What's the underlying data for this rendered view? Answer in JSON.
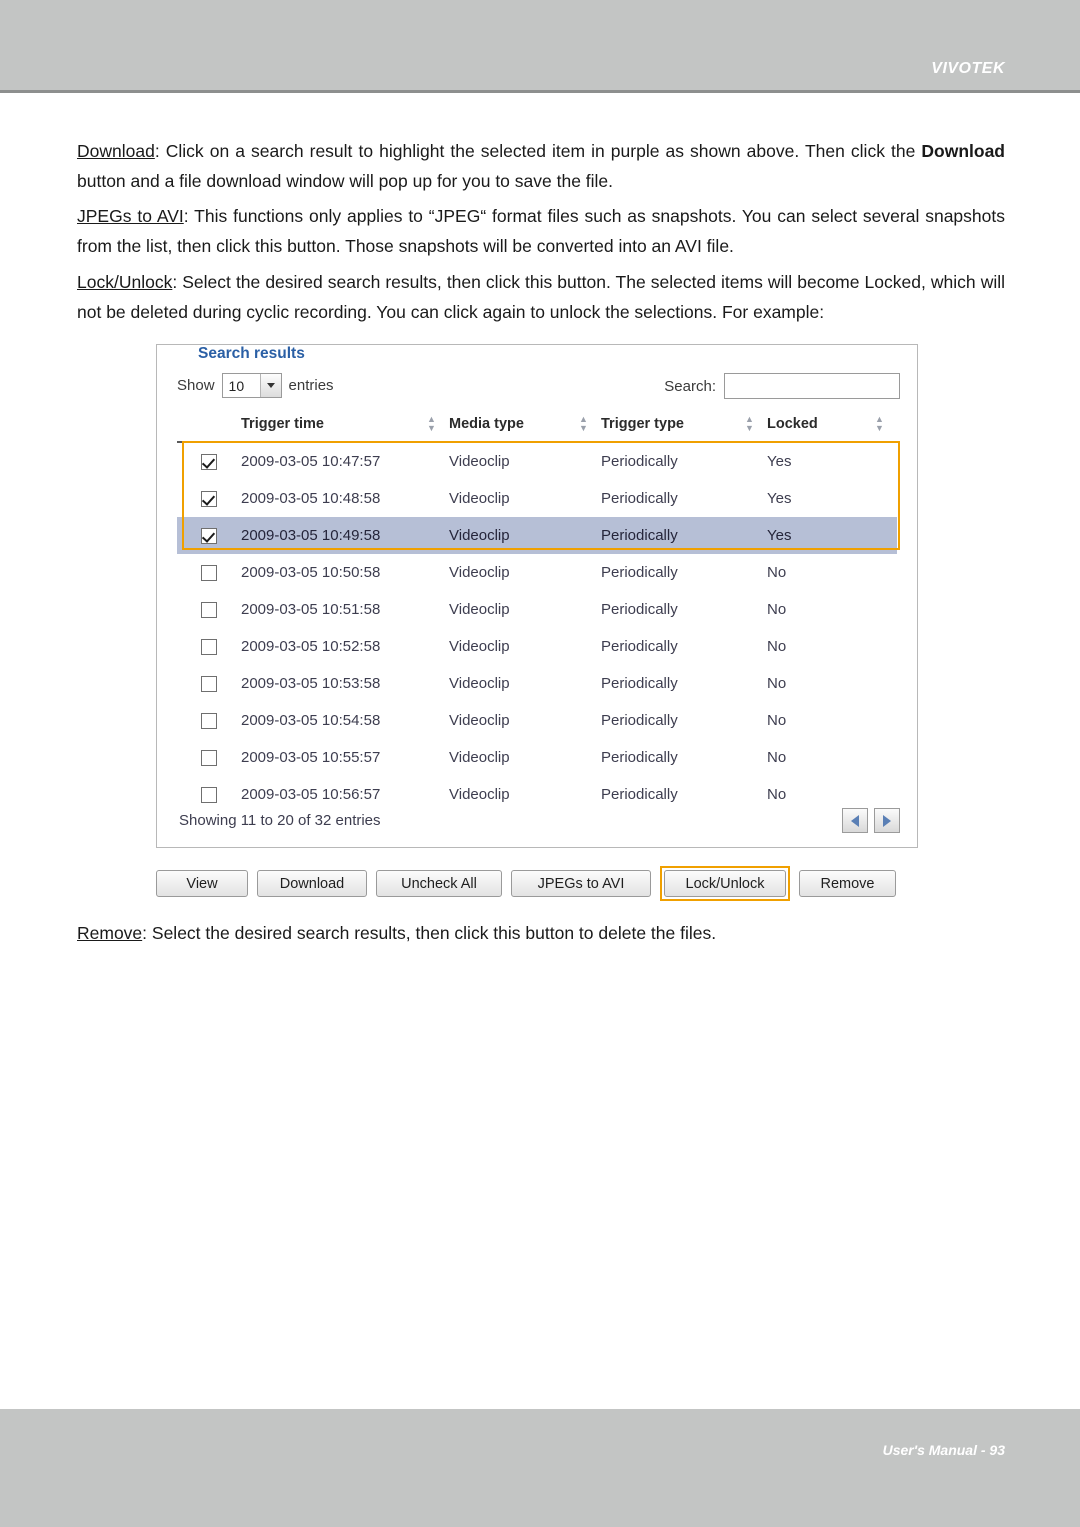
{
  "header": {
    "brand": "VIVOTEK"
  },
  "footer": {
    "text": "User's Manual - 93"
  },
  "paragraphs": {
    "download_label": "Download",
    "download_rest": ": Click on a search result to highlight the selected item in purple as shown above. Then click the ",
    "download_bold": "Download",
    "download_tail": " button and a file download window will pop up for you to save the file.",
    "jpegs_label": "JPEGs to AVI",
    "jpegs_rest": ": This functions only applies to “JPEG“ format files such as snapshots. You can select several snapshots from the list, then click this button. Those snapshots will be converted into an AVI file.",
    "lock_label": "Lock/Unlock",
    "lock_rest": ": Select the desired search results, then click this button. The selected items will become Locked, which will not be deleted during cyclic recording. You can click again to unlock the selections. For example:",
    "remove_label": "Remove",
    "remove_rest": ": Select the desired search results, then click this button to delete the files."
  },
  "panel": {
    "legend": "Search results",
    "show_label": "Show",
    "show_value": "10",
    "entries_label": "entries",
    "search_label": "Search:",
    "search_value": "",
    "showing_text": "Showing 11 to 20 of 32 entries",
    "columns": [
      "Trigger time",
      "Media type",
      "Trigger type",
      "Locked"
    ],
    "rows": [
      {
        "checked": true,
        "selected": false,
        "time": "2009-03-05 10:47:57",
        "media": "Videoclip",
        "trigger": "Periodically",
        "locked": "Yes"
      },
      {
        "checked": true,
        "selected": false,
        "time": "2009-03-05 10:48:58",
        "media": "Videoclip",
        "trigger": "Periodically",
        "locked": "Yes"
      },
      {
        "checked": true,
        "selected": true,
        "time": "2009-03-05 10:49:58",
        "media": "Videoclip",
        "trigger": "Periodically",
        "locked": "Yes"
      },
      {
        "checked": false,
        "selected": false,
        "time": "2009-03-05 10:50:58",
        "media": "Videoclip",
        "trigger": "Periodically",
        "locked": "No"
      },
      {
        "checked": false,
        "selected": false,
        "time": "2009-03-05 10:51:58",
        "media": "Videoclip",
        "trigger": "Periodically",
        "locked": "No"
      },
      {
        "checked": false,
        "selected": false,
        "time": "2009-03-05 10:52:58",
        "media": "Videoclip",
        "trigger": "Periodically",
        "locked": "No"
      },
      {
        "checked": false,
        "selected": false,
        "time": "2009-03-05 10:53:58",
        "media": "Videoclip",
        "trigger": "Periodically",
        "locked": "No"
      },
      {
        "checked": false,
        "selected": false,
        "time": "2009-03-05 10:54:58",
        "media": "Videoclip",
        "trigger": "Periodically",
        "locked": "No"
      },
      {
        "checked": false,
        "selected": false,
        "time": "2009-03-05 10:55:57",
        "media": "Videoclip",
        "trigger": "Periodically",
        "locked": "No"
      },
      {
        "checked": false,
        "selected": false,
        "time": "2009-03-05 10:56:57",
        "media": "Videoclip",
        "trigger": "Periodically",
        "locked": "No"
      }
    ]
  },
  "buttons": {
    "view": "View",
    "download": "Download",
    "uncheck_all": "Uncheck All",
    "jpegs_to_avi": "JPEGs to AVI",
    "lock_unlock": "Lock/Unlock",
    "remove": "Remove"
  },
  "colors": {
    "band": "#c3c5c4",
    "legend_blue": "#2a5fa5",
    "highlight_orange": "#f0a000",
    "selected_row": "#b6bfd6"
  }
}
